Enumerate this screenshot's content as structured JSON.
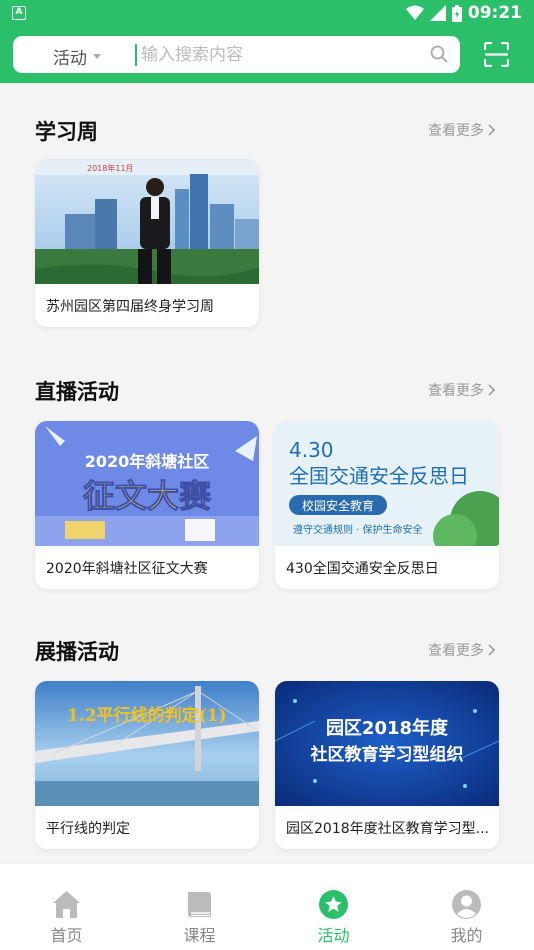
{
  "status_bar": {
    "time": "09:21",
    "app_badge": "A"
  },
  "search": {
    "category": "活动",
    "placeholder": "输入搜索内容"
  },
  "sections": [
    {
      "title": "学习周",
      "more_label": "查看更多",
      "cards": [
        {
          "label": "苏州园区第四届终身学习周",
          "image_text": "2018年11月"
        }
      ]
    },
    {
      "title": "直播活动",
      "more_label": "查看更多",
      "cards": [
        {
          "label": "2020年斜塘社区征文大赛",
          "image_text_1": "2020年斜塘社区",
          "image_text_2": "征文大赛"
        },
        {
          "label": "430全国交通安全反思日",
          "image_text_1": "4.30",
          "image_text_2": "全国交通安全反思日",
          "image_text_3": "校园安全教育",
          "image_text_4": "遵守交通规则 · 保护生命安全"
        }
      ]
    },
    {
      "title": "展播活动",
      "more_label": "查看更多",
      "cards": [
        {
          "label": "平行线的判定",
          "image_text": "1.2平行线的判定(1)"
        },
        {
          "label": "园区2018年度社区教育学习型...",
          "image_text_1": "园区2018年度",
          "image_text_2": "社区教育学习型组织"
        }
      ]
    }
  ],
  "bottom_nav": [
    {
      "label": "首页",
      "icon": "home-icon",
      "active": false
    },
    {
      "label": "课程",
      "icon": "book-icon",
      "active": false
    },
    {
      "label": "活动",
      "icon": "star-icon",
      "active": true
    },
    {
      "label": "我的",
      "icon": "person-icon",
      "active": false
    }
  ],
  "colors": {
    "brand": "#2bbf6a",
    "inactive": "#bbbbbb"
  }
}
